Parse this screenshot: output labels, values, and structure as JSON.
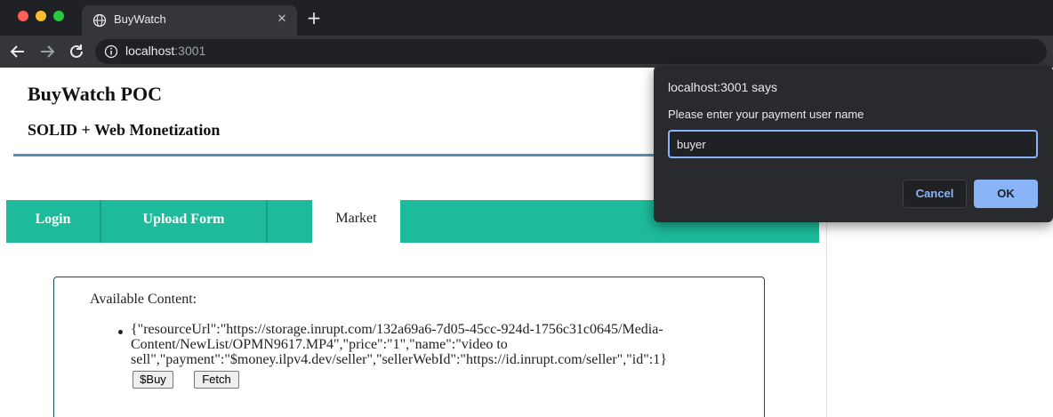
{
  "browser": {
    "tab": {
      "title": "BuyWatch",
      "close_symbol": "✕",
      "icon": "globe-icon"
    },
    "new_tab_symbol": "+",
    "address": {
      "host": "localhost",
      "port": ":3001"
    },
    "colors": {
      "chrome_dark": "#202124",
      "chrome_toolbar": "#35363a",
      "accent_blue": "#8ab4f8"
    }
  },
  "page": {
    "title": "BuyWatch POC",
    "subtitle": "SOLID + Web Monetization",
    "nav": {
      "login": "Login",
      "upload": "Upload Form",
      "market": "Market",
      "active": "market"
    },
    "colors": {
      "nav_bg": "#1dbb9c",
      "header_rule": "#5b8fb2",
      "box_border": "#1b4d5c"
    },
    "content": {
      "heading": "Available Content:",
      "items": [
        {
          "text": "{\"resourceUrl\":\"https://storage.inrupt.com/132a69a6-7d05-45cc-924d-1756c31c0645/Media-Content/NewList/OPMN9617.MP4\",\"price\":\"1\",\"name\":\"video to sell\",\"payment\":\"$money.ilpv4.dev/seller\",\"sellerWebId\":\"https://id.inrupt.com/seller\",\"id\":1}",
          "buy_label": "$Buy",
          "fetch_label": "Fetch"
        }
      ]
    }
  },
  "dialog": {
    "title": "localhost:3001 says",
    "message": "Please enter your payment user name",
    "input_value": "buyer",
    "cancel_label": "Cancel",
    "ok_label": "OK"
  }
}
